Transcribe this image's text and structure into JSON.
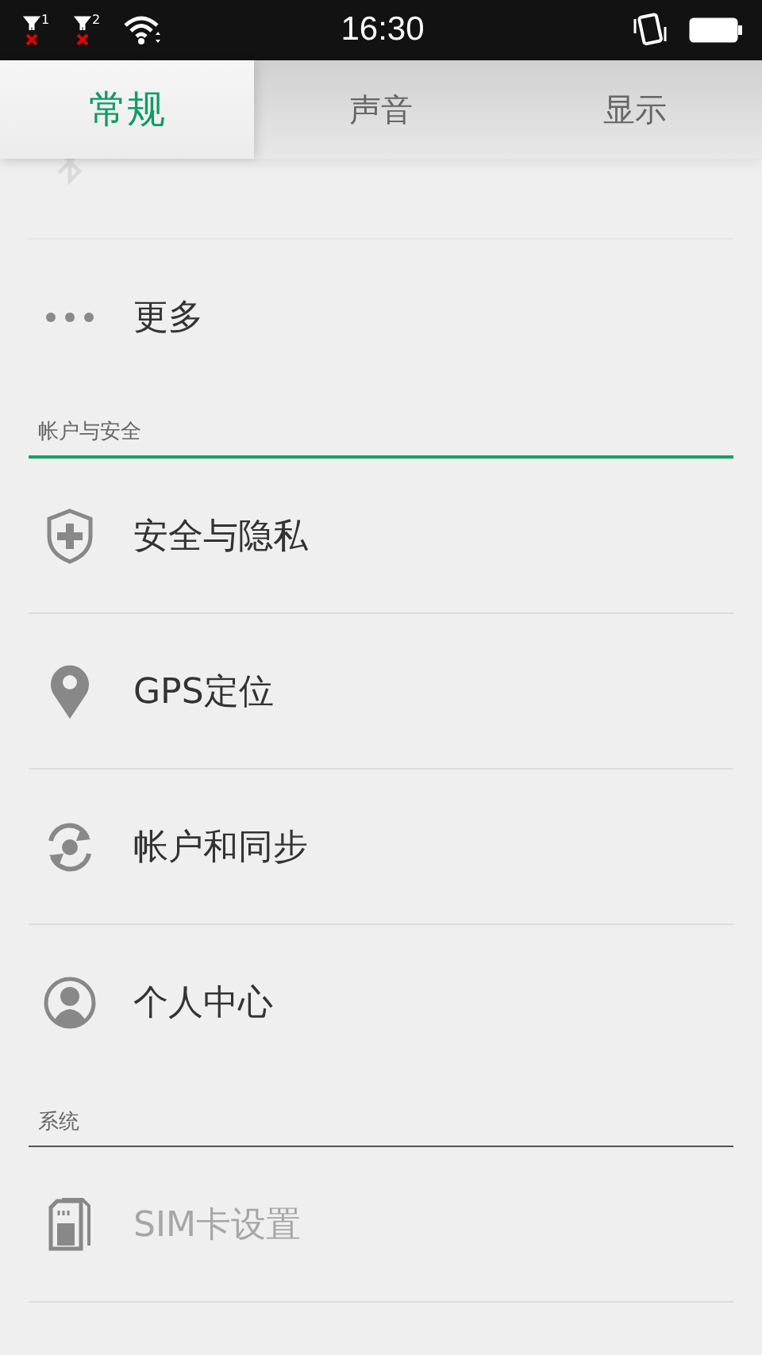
{
  "status_bar": {
    "sim_slots": [
      {
        "label": "1"
      },
      {
        "label": "2"
      }
    ],
    "time": "16:30"
  },
  "tabs": [
    {
      "label": "常规",
      "selected": true
    },
    {
      "label": "声音",
      "selected": false
    },
    {
      "label": "显示",
      "selected": false
    }
  ],
  "sections": [
    {
      "items": [
        {
          "kind": "bluetooth"
        },
        {
          "kind": "more",
          "label": "更多",
          "disabled": false
        }
      ]
    },
    {
      "header": "帐户与安全",
      "items": [
        {
          "kind": "shield",
          "label": "安全与隐私",
          "disabled": false
        },
        {
          "kind": "location",
          "label": "GPS定位",
          "disabled": false
        },
        {
          "kind": "sync",
          "label": "帐户和同步",
          "disabled": false
        },
        {
          "kind": "person",
          "label": "个人中心",
          "disabled": false
        }
      ]
    },
    {
      "header": "系统",
      "items": [
        {
          "kind": "sim",
          "label": "SIM卡设置",
          "disabled": true
        }
      ]
    }
  ]
}
